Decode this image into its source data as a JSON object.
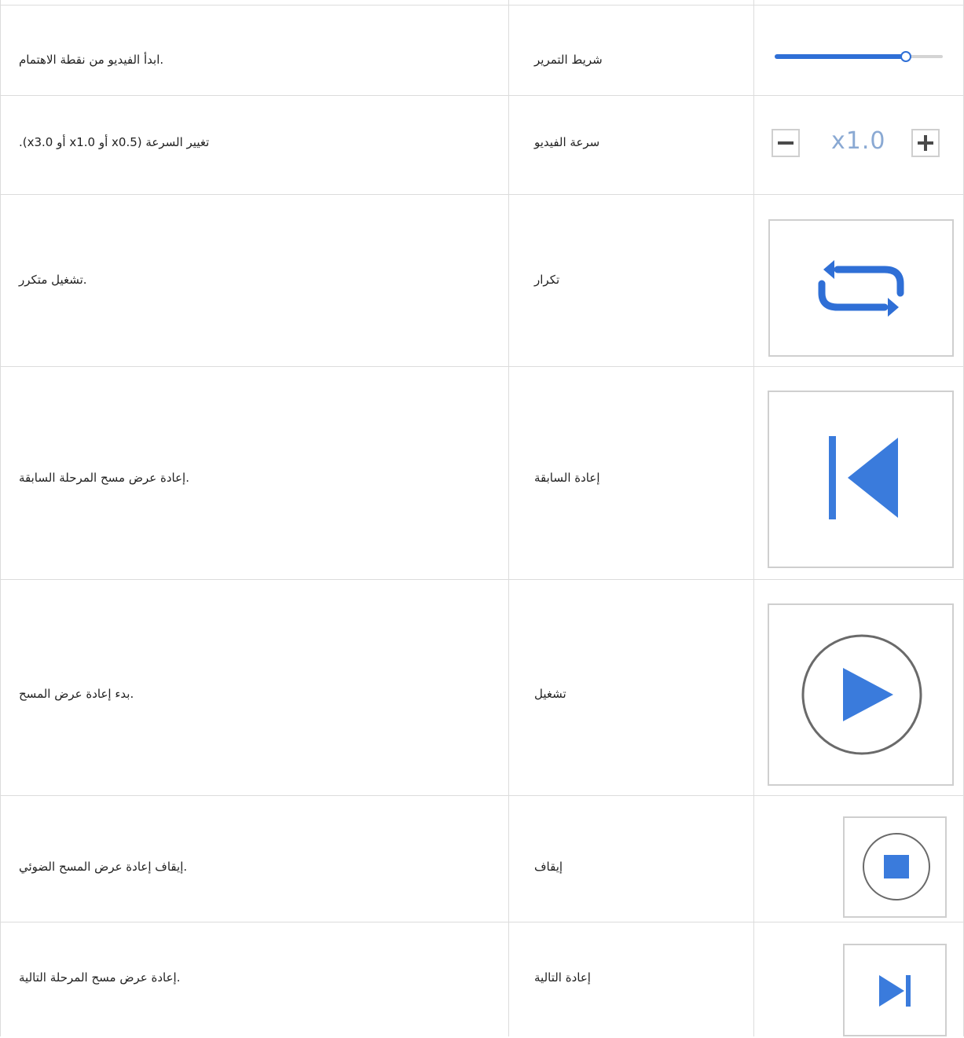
{
  "colors": {
    "accent": "#2f6fd6",
    "accent_light": "#8aa9d3",
    "border": "#dcdcdc",
    "icon_border": "#cfcfcf"
  },
  "rows": [
    {
      "name": "شريط التمرير",
      "desc": ".ابدأ الفيديو من نقطة الاهتمام",
      "icon": "slider-icon"
    },
    {
      "name": "سرعة الفيديو",
      "desc": ".(x3.0 أو x1.0 أو x0.5) تغيير السرعة",
      "icon": "speed-control",
      "speed_value": "x1.0",
      "speed_minus": "−",
      "speed_plus": "+"
    },
    {
      "name": "تكرار",
      "desc": ".تشغيل متكرر",
      "icon": "repeat-icon"
    },
    {
      "name": "إعادة السابقة",
      "desc": ".إعادة عرض مسح المرحلة السابقة",
      "icon": "skip-previous-icon"
    },
    {
      "name": "تشغيل",
      "desc": ".بدء إعادة عرض المسح",
      "icon": "play-icon"
    },
    {
      "name": "إيقاف",
      "desc": ".إيقاف إعادة عرض المسح الضوئي",
      "icon": "stop-icon"
    },
    {
      "name": "إعادة التالية",
      "desc": ".إعادة عرض مسح المرحلة التالية",
      "icon": "skip-next-icon"
    }
  ],
  "slider": {
    "value_fraction": 0.78
  }
}
